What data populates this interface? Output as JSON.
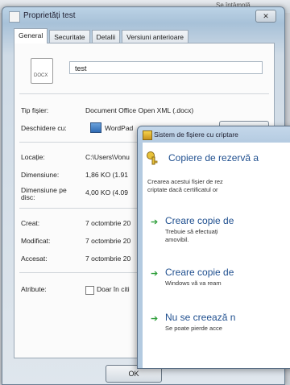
{
  "background": {
    "partial_text": "Se întâmplă"
  },
  "window": {
    "title": "Proprietăți test",
    "close_label": "✕",
    "tabs": [
      "General",
      "Securitate",
      "Detalii",
      "Versiuni anterioare"
    ]
  },
  "general": {
    "file_icon_text": "DOCX",
    "file_name": "test",
    "type_label": "Tip fișier:",
    "type_value": "Document Office Open XML (.docx)",
    "opens_label": "Deschidere cu:",
    "opens_value": "WordPad",
    "location_label": "Locație:",
    "location_value": "C:\\Users\\Vonu",
    "size_label": "Dimensiune:",
    "size_value": "1,86 KO (1.91",
    "size_disk_label": "Dimensiune pe disc:",
    "size_disk_value": "4,00 KO (4.09",
    "created_label": "Creat:",
    "created_value": "7 octombrie 20",
    "modified_label": "Modificat:",
    "modified_value": "7 octombrie 20",
    "accessed_label": "Accesat:",
    "accessed_value": "7 octombrie 20",
    "attributes_label": "Atribute:",
    "readonly_label": "Doar în citi"
  },
  "ok_label": "OK",
  "efs": {
    "title": "Sistem de fișiere cu criptare",
    "header": "Copiere de rezervă a",
    "desc_line1": "Crearea acestui fișier de rez",
    "desc_line2": "criptate dacă certificatul or",
    "options": [
      {
        "title": "Creare copie de",
        "desc1": "Trebuie să efectuați",
        "desc2": "amovibil."
      },
      {
        "title": "Creare copie de",
        "desc1": "Windows vă va ream",
        "desc2": ""
      },
      {
        "title": "Nu se creează n",
        "desc1": "Se poate pierde acce",
        "desc2": ""
      }
    ]
  }
}
